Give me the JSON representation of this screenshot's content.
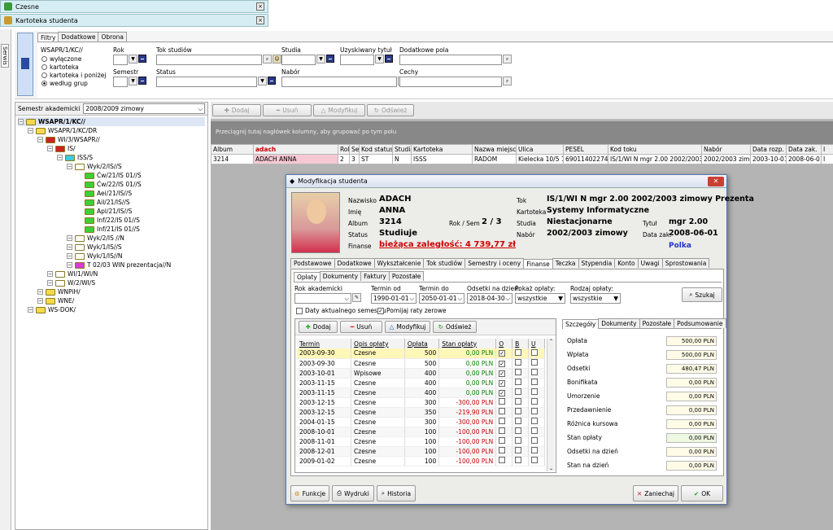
{
  "windows": [
    {
      "title": "Czesne",
      "close": "×"
    },
    {
      "title": "Kartoteka studenta",
      "close": "×"
    }
  ],
  "side_tab": "Serwis",
  "filter_tabs": [
    "Filtry",
    "Dodatkowe",
    "Obrona"
  ],
  "filter": {
    "unit": "WSAPR/1/KC//",
    "radio": [
      "wyłączone",
      "kartoteka",
      "kartoteka i poniżej",
      "według grup"
    ],
    "rok_label": "Rok",
    "semestr_label": "Semestr",
    "tok_label": "Tok studiów",
    "status_label": "Status",
    "studia_label": "Studia",
    "nabor_label": "Nabór",
    "tytul_label": "Uzyskiwany tytuł",
    "dod_pola_label": "Dodatkowe pola",
    "cechy_label": "Cechy"
  },
  "semester_label": "Semestr akademicki",
  "semester_value": "2008/2009 zimowy",
  "tree": [
    {
      "t": "WSAPR/1/KC//",
      "d": 0,
      "c": "#f6d94a",
      "bold": true
    },
    {
      "t": "WSAPR/1/KC/DR",
      "d": 1,
      "c": "#f6d94a"
    },
    {
      "t": "WI/3/WSAPR//",
      "d": 2,
      "c": "#cc2222"
    },
    {
      "t": "IS/",
      "d": 3,
      "c": "#cc2222"
    },
    {
      "t": "ISS/S",
      "d": 4,
      "c": "#44c8d8"
    },
    {
      "t": "Wyk/2/IS//S",
      "d": 5,
      "c": "#ffffff"
    },
    {
      "t": "Ćw/21/IS 01//S",
      "d": 6,
      "c": "#3bd03b"
    },
    {
      "t": "Ćw/22/IS 01//S",
      "d": 6,
      "c": "#3bd03b"
    },
    {
      "t": "Aei/21/IS//S",
      "d": 6,
      "c": "#3bd03b"
    },
    {
      "t": "Ail/21/IS//S",
      "d": 6,
      "c": "#3bd03b"
    },
    {
      "t": "Apl/21/IS//S",
      "d": 6,
      "c": "#3bd03b"
    },
    {
      "t": "Inf/22/IS 01//S",
      "d": 6,
      "c": "#3bd03b"
    },
    {
      "t": "Inf/21/IS 01//S",
      "d": 6,
      "c": "#3bd03b"
    },
    {
      "t": "Wyk/2/IS //N",
      "d": 5,
      "c": "#ffffff"
    },
    {
      "t": "Wyk/1/IS//S",
      "d": 5,
      "c": "#ffffff"
    },
    {
      "t": "Wyk/1/IS//N",
      "d": 5,
      "c": "#ffffff"
    },
    {
      "t": "T 02/03 WIN prezentacja//N",
      "d": 5,
      "c": "#d63bd6"
    },
    {
      "t": "WI/1/WI/N",
      "d": 3,
      "c": "#ffffff"
    },
    {
      "t": "W/2/WI/S",
      "d": 3,
      "c": "#ffffff"
    },
    {
      "t": "WNPiH/",
      "d": 2,
      "c": "#f6d94a"
    },
    {
      "t": "WNE/",
      "d": 2,
      "c": "#f6d94a"
    },
    {
      "t": "WS-DOK/",
      "d": 1,
      "c": "#f6d94a"
    }
  ],
  "toolbar": {
    "add": "Dodaj",
    "del": "Usuń",
    "mod": "Modyfikuj",
    "ref": "Odśwież"
  },
  "group_hint": "Przeciągnij tutaj nagłówek kolumny, aby grupować po tym polu",
  "grid_headers": [
    "Album",
    "adach",
    "Rok",
    "Sem",
    "Kod status",
    "Studia",
    "Kartoteka",
    "Nazwa miejscow",
    "Ulica",
    "PESEL",
    "Kod toku",
    "Nabór",
    "Data rozp.",
    "Data zak.",
    "I"
  ],
  "grid_row": [
    "3214",
    "ADACH ANNA",
    "2",
    "3",
    "ST",
    "N",
    "ISSS",
    "RADOM",
    "Kielecka 10/5 10/",
    "69011402274",
    "IS/1/WI N mgr 2.00 2002/2003 z",
    "2002/2003 zimo",
    "2003-10-01",
    "2008-06-01",
    "I"
  ],
  "dialog": {
    "title": "Modyfikacja studenta",
    "nazwisko_l": "Nazwisko",
    "nazwisko": "ADACH",
    "imie_l": "Imię",
    "imie": "ANNA",
    "album_l": "Album",
    "album": "3214",
    "rok_sem_l": "Rok / Sem",
    "rok_sem": "2 / 3",
    "status_l": "Status",
    "status": "Studiuje",
    "finanse_l": "Finanse",
    "finanse": "bieżąca zaległość: 4 739,77 zł",
    "tok_l": "Tok",
    "tok": "IS/1/WI N mgr 2.00 2002/2003 zimowy Prezenta",
    "kartoteka_l": "Kartoteka",
    "kartoteka": "Systemy Informatyczne",
    "studia_l": "Studia",
    "studia": "Niestacjonarne",
    "tytul_l": "Tytuł",
    "tytul": "mgr 2.00",
    "nabor_l": "Nabór",
    "nabor": "2002/2003 zimowy",
    "datazak_l": "Data zak.",
    "datazak": "2008-06-01",
    "kraj": "Polka",
    "tabs": [
      "Podstawowe",
      "Dodatkowe",
      "Wykształcenie",
      "Tok studiów",
      "Semestry i oceny",
      "Finanse",
      "Teczka",
      "Stypendia",
      "Konto",
      "Uwagi",
      "Sprostowania"
    ],
    "subtabs": [
      "Opłaty",
      "Dokumenty",
      "Faktury",
      "Pozostałe"
    ],
    "f_rok_l": "Rok akademicki",
    "f_od_l": "Termin od",
    "f_od": "1990-01-01",
    "f_do_l": "Termin do",
    "f_do": "2050-01-01",
    "f_ods_l": "Odsetki na dzień:",
    "f_ods": "2018-04-30",
    "f_pok_l": "Pokaż opłaty:",
    "f_pok": "wszystkie",
    "f_rodz_l": "Rodzaj opłaty:",
    "f_rodz": "wszystkie",
    "search": "Szukaj",
    "chk1": "Daty aktualnego semestru",
    "chk2": "Pomijaj raty zerowe",
    "btn_add": "Dodaj",
    "btn_del": "Usuń",
    "btn_mod": "Modyfikuj",
    "btn_ref": "Odśwież",
    "pay_headers": [
      "Termin",
      "Opis opłaty",
      "Opłata",
      "Stan opłaty",
      "O",
      "B",
      "U"
    ],
    "payments": [
      [
        "2003-09-30",
        "Czesne",
        "500",
        "0,00 PLN",
        "g",
        true
      ],
      [
        "2003-09-30",
        "Czesne",
        "500",
        "0,00 PLN",
        "g",
        true
      ],
      [
        "2003-10-01",
        "Wpisowe",
        "400",
        "0,00 PLN",
        "g",
        true
      ],
      [
        "2003-11-15",
        "Czesne",
        "400",
        "0,00 PLN",
        "g",
        true
      ],
      [
        "2003-11-15",
        "Czesne",
        "400",
        "0,00 PLN",
        "g",
        true
      ],
      [
        "2003-12-15",
        "Czesne",
        "300",
        "-300,00 PLN",
        "r",
        false
      ],
      [
        "2003-12-15",
        "Czesne",
        "350",
        "-219,90 PLN",
        "r",
        false
      ],
      [
        "2004-01-15",
        "Czesne",
        "300",
        "-300,00 PLN",
        "r",
        false
      ],
      [
        "2008-10-01",
        "Czesne",
        "100",
        "-100,00 PLN",
        "r",
        false
      ],
      [
        "2008-11-01",
        "Czesne",
        "100",
        "-100,00 PLN",
        "r",
        false
      ],
      [
        "2008-12-01",
        "Czesne",
        "100",
        "-100,00 PLN",
        "r",
        false
      ],
      [
        "2009-01-02",
        "Czesne",
        "100",
        "-100,00 PLN",
        "r",
        false
      ]
    ],
    "sum_tabs": [
      "Szczegóły",
      "Dokumenty",
      "Pozostałe",
      "Podsumowanie"
    ],
    "summary": [
      [
        "Opłata",
        "500,00 PLN",
        false
      ],
      [
        "Wpłata",
        "500,00 PLN",
        false
      ],
      [
        "Odsetki",
        "480,47 PLN",
        false
      ],
      [
        "Bonifikata",
        "0,00 PLN",
        false
      ],
      [
        "Umorzenie",
        "0,00 PLN",
        false
      ],
      [
        "Przedawnienie",
        "0,00 PLN",
        false
      ],
      [
        "Różnica kursowa",
        "0,00 PLN",
        false
      ],
      [
        "Stan opłaty",
        "0,00 PLN",
        true
      ],
      [
        "Odsetki na dzień",
        "0,00 PLN",
        false
      ],
      [
        "Stan na dzień",
        "0,00 PLN",
        false
      ]
    ],
    "b_funkcje": "Funkcje",
    "b_wydruki": "Wydruki",
    "b_historia": "Historia",
    "b_zaniechaj": "Zaniechaj",
    "b_ok": "OK"
  }
}
